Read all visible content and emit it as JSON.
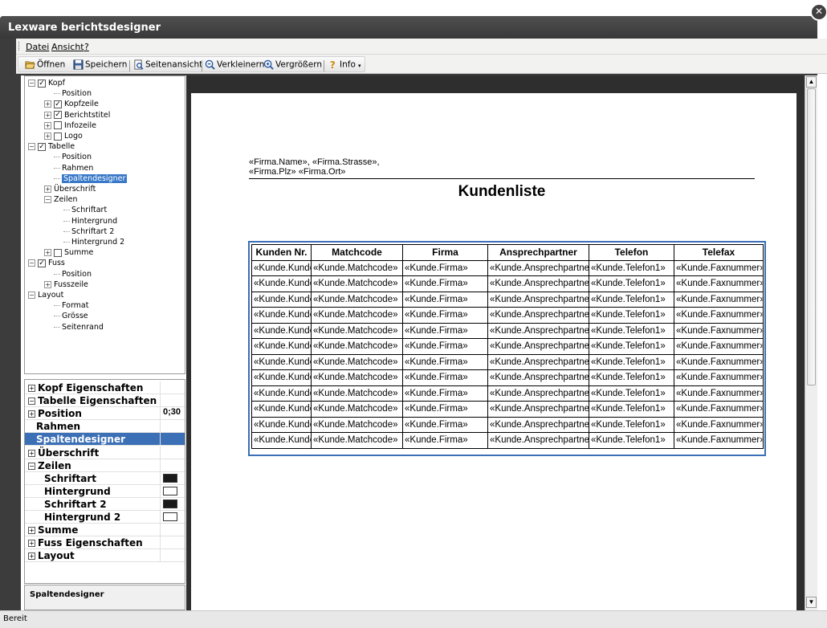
{
  "window": {
    "title": "Lexware berichtsdesigner",
    "close_glyph": "✕"
  },
  "menu": {
    "items": [
      "Datei",
      "Ansicht",
      "?"
    ]
  },
  "toolbar": {
    "open_label": "Öffnen",
    "save_label": "Speichern",
    "preview_label": "Seitenansicht",
    "zoom_out_label": "Verkleinern",
    "zoom_in_label": "Vergrößern",
    "info_label": "Info"
  },
  "tree": {
    "nodes": [
      {
        "label": "Kopf",
        "checked": true,
        "expander": "−"
      },
      {
        "label": "Position"
      },
      {
        "label": "Kopfzeile",
        "checked": true,
        "expander": "+"
      },
      {
        "label": "Berichtstitel",
        "checked": true,
        "expander": "+"
      },
      {
        "label": "Infozeile",
        "checked": false,
        "expander": "+"
      },
      {
        "label": "Logo",
        "checked": false,
        "expander": "+"
      },
      {
        "label": "Tabelle",
        "checked": true,
        "expander": "−"
      },
      {
        "label": "Position"
      },
      {
        "label": "Rahmen"
      },
      {
        "label": "Spaltendesigner"
      },
      {
        "label": "Überschrift",
        "expander": "+"
      },
      {
        "label": "Zeilen",
        "expander": "−"
      },
      {
        "label": "Schriftart"
      },
      {
        "label": "Hintergrund"
      },
      {
        "label": "Schriftart 2"
      },
      {
        "label": "Hintergrund 2"
      },
      {
        "label": "Summe",
        "checked": false,
        "expander": "+"
      },
      {
        "label": "Fuss",
        "checked": true,
        "expander": "−"
      },
      {
        "label": "Position"
      },
      {
        "label": "Fusszeile",
        "expander": "+"
      },
      {
        "label": "Layout",
        "expander": "−"
      },
      {
        "label": "Format"
      },
      {
        "label": "Grösse"
      },
      {
        "label": "Seitenrand"
      }
    ]
  },
  "properties": {
    "rows": [
      {
        "label": "Kopf Eigenschaften",
        "expander": "+",
        "value": ""
      },
      {
        "label": "Tabelle Eigenschaften",
        "expander": "−",
        "value": ""
      },
      {
        "label": "Position",
        "expander": "+",
        "value": "0;30"
      },
      {
        "label": "Rahmen",
        "value": ""
      },
      {
        "label": "Spaltendesigner",
        "value": ""
      },
      {
        "label": "Überschrift",
        "expander": "+",
        "value": ""
      },
      {
        "label": "Zeilen",
        "expander": "−",
        "value": ""
      },
      {
        "label": "Schriftart",
        "value": "",
        "swatch": "#1a1a1a"
      },
      {
        "label": "Hintergrund",
        "value": "",
        "swatch": "#ffffff"
      },
      {
        "label": "Schriftart 2",
        "value": "",
        "swatch": "#1a1a1a"
      },
      {
        "label": "Hintergrund 2",
        "value": "",
        "swatch": "#ffffff"
      },
      {
        "label": "Summe",
        "expander": "+",
        "value": ""
      },
      {
        "label": "Fuss Eigenschaften",
        "expander": "+",
        "value": ""
      },
      {
        "label": "Layout",
        "expander": "+",
        "value": ""
      }
    ],
    "description_title": "Spaltendesigner"
  },
  "report": {
    "address_line1": "«Firma.Name», «Firma.Strasse»,",
    "address_line2": "«Firma.Plz» «Firma.Ort»",
    "title": "Kundenliste",
    "columns": [
      "Kunden Nr.",
      "Matchcode",
      "Firma",
      "Ansprechpartner",
      "Telefon",
      "Telefax"
    ],
    "row_template": [
      "«Kunde.Kundennummer»",
      "«Kunde.Matchcode»",
      "«Kunde.Firma»",
      "«Kunde.Ansprechpartner»",
      "«Kunde.Telefon1»",
      "«Kunde.Faxnummer»"
    ],
    "row_count": 12
  },
  "status": {
    "text": "Bereit"
  },
  "colors": {
    "selection": "#3b6fb6",
    "frame": "#3c3c3c"
  }
}
